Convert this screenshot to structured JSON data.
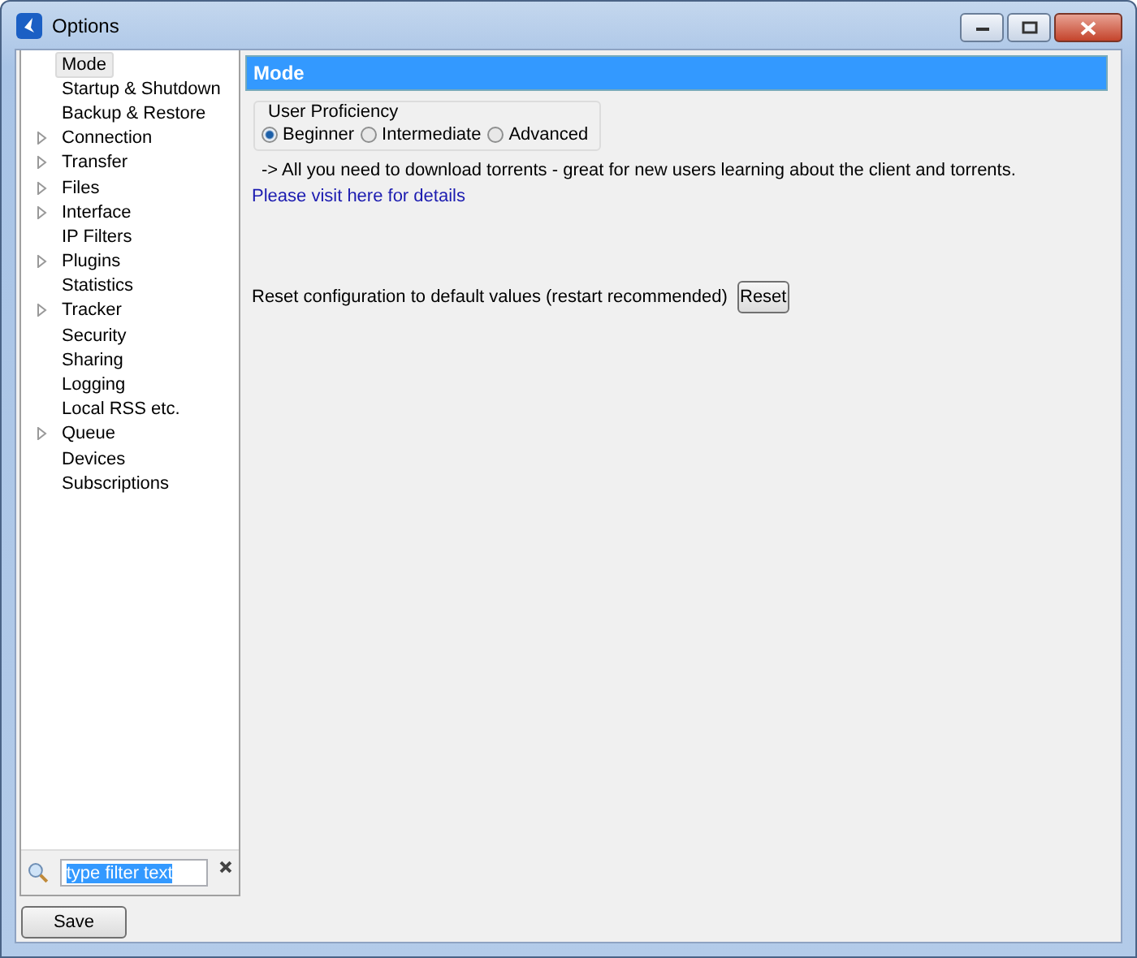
{
  "window": {
    "title": "Options"
  },
  "sidebar": {
    "items": [
      {
        "label": "Mode",
        "expandable": false,
        "selected": true
      },
      {
        "label": "Startup & Shutdown",
        "expandable": false,
        "selected": false
      },
      {
        "label": "Backup & Restore",
        "expandable": false,
        "selected": false
      },
      {
        "label": "Connection",
        "expandable": true,
        "selected": false
      },
      {
        "label": "Transfer",
        "expandable": true,
        "selected": false
      },
      {
        "label": "Files",
        "expandable": true,
        "selected": false
      },
      {
        "label": "Interface",
        "expandable": true,
        "selected": false
      },
      {
        "label": "IP Filters",
        "expandable": false,
        "selected": false
      },
      {
        "label": "Plugins",
        "expandable": true,
        "selected": false
      },
      {
        "label": "Statistics",
        "expandable": false,
        "selected": false
      },
      {
        "label": "Tracker",
        "expandable": true,
        "selected": false
      },
      {
        "label": "Security",
        "expandable": false,
        "selected": false
      },
      {
        "label": "Sharing",
        "expandable": false,
        "selected": false
      },
      {
        "label": "Logging",
        "expandable": false,
        "selected": false
      },
      {
        "label": "Local RSS etc.",
        "expandable": false,
        "selected": false
      },
      {
        "label": "Queue",
        "expandable": true,
        "selected": false
      },
      {
        "label": "Devices",
        "expandable": false,
        "selected": false
      },
      {
        "label": "Subscriptions",
        "expandable": false,
        "selected": false
      }
    ],
    "filter": {
      "value": "type filter text"
    }
  },
  "panel": {
    "title": "Mode",
    "proficiency": {
      "label": "User Proficiency",
      "options": [
        {
          "label": "Beginner",
          "selected": true
        },
        {
          "label": "Intermediate",
          "selected": false
        },
        {
          "label": "Advanced",
          "selected": false
        }
      ]
    },
    "description": "-> All you need to download torrents - great for new users learning about the client and torrents.",
    "link": "Please visit here for details",
    "reset_label": "Reset configuration to default values (restart recommended)",
    "reset_button": "Reset"
  },
  "buttons": [
    "Save"
  ]
}
